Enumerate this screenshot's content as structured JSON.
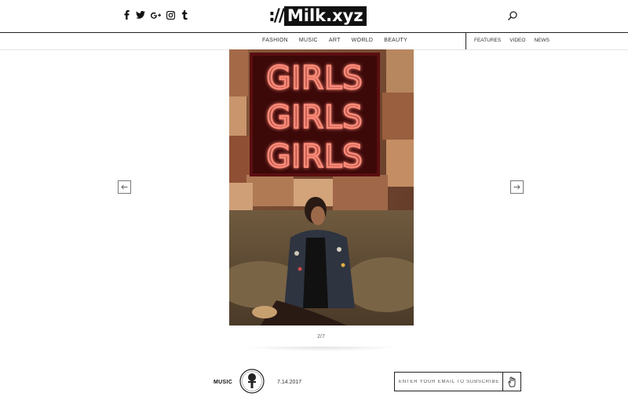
{
  "header": {
    "logo_slashes": "://",
    "logo_text": "Milk.xyz",
    "social": [
      {
        "icon": "facebook-icon",
        "glyph": "f"
      },
      {
        "icon": "twitter-icon",
        "glyph": "t"
      },
      {
        "icon": "google-plus-icon",
        "glyph": "g+"
      },
      {
        "icon": "instagram-icon",
        "glyph": "ig"
      },
      {
        "icon": "tumblr-icon",
        "glyph": "t"
      }
    ]
  },
  "nav": {
    "main": [
      "FASHION",
      "MUSIC",
      "ART",
      "WORLD",
      "BEAUTY"
    ],
    "secondary": [
      "FEATURES",
      "VIDEO",
      "NEWS"
    ]
  },
  "gallery": {
    "counter": "2/7",
    "sign_lines": [
      "GIRLS",
      "GIRLS",
      "GIRLS"
    ],
    "prev_icon": "arrow-left-icon",
    "next_icon": "arrow-right-icon"
  },
  "footer": {
    "category": "MUSIC",
    "date": "7.14.2017",
    "subscribe_placeholder": "ENTER YOUR EMAIL TO SUBSCRIBE"
  },
  "colors": {
    "neon": "#ff6a5c",
    "text": "#222222"
  }
}
